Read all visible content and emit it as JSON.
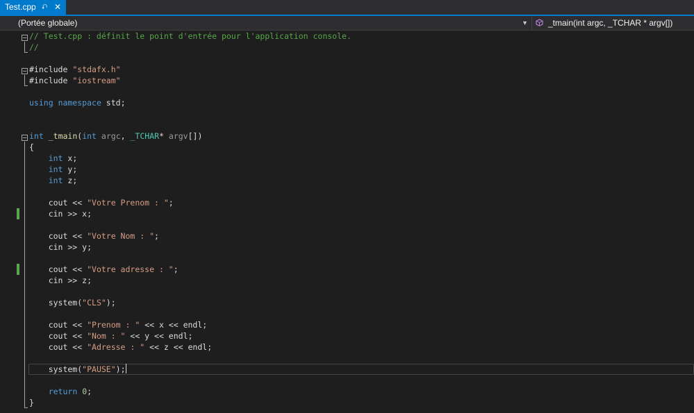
{
  "tab": {
    "title": "Test.cpp",
    "pin_icon": "pin-icon",
    "close_icon": "close-icon",
    "accent": "#007acc"
  },
  "navbar": {
    "scope_label": "(Portée globale)",
    "member_label": "_tmain(int argc, _TCHAR * argv[])",
    "member_icon": "function-cube-icon"
  },
  "code": {
    "lines": [
      [
        {
          "t": "// Test.cpp : définit le point d'entrée pour l'application console.",
          "c": "cmt"
        }
      ],
      [
        {
          "t": "//",
          "c": "cmt"
        }
      ],
      [],
      [
        {
          "t": "#include ",
          "c": ""
        },
        {
          "t": "\"stdafx.h\"",
          "c": "str"
        }
      ],
      [
        {
          "t": "#include ",
          "c": ""
        },
        {
          "t": "\"iostream\"",
          "c": "str"
        }
      ],
      [],
      [
        {
          "t": "using",
          "c": "kw"
        },
        {
          "t": " ",
          "c": ""
        },
        {
          "t": "namespace",
          "c": "kw"
        },
        {
          "t": " std;",
          "c": ""
        }
      ],
      [],
      [],
      [
        {
          "t": "int",
          "c": "kw"
        },
        {
          "t": " ",
          "c": ""
        },
        {
          "t": "_tmain",
          "c": "fn"
        },
        {
          "t": "(",
          "c": ""
        },
        {
          "t": "int",
          "c": "kw"
        },
        {
          "t": " ",
          "c": ""
        },
        {
          "t": "argc",
          "c": "param"
        },
        {
          "t": ", ",
          "c": ""
        },
        {
          "t": "_TCHAR",
          "c": "ty"
        },
        {
          "t": "* ",
          "c": ""
        },
        {
          "t": "argv",
          "c": "param"
        },
        {
          "t": "[])",
          "c": ""
        }
      ],
      [
        {
          "t": "{",
          "c": ""
        }
      ],
      [
        {
          "t": "    ",
          "c": ""
        },
        {
          "t": "int",
          "c": "kw"
        },
        {
          "t": " x;",
          "c": ""
        }
      ],
      [
        {
          "t": "    ",
          "c": ""
        },
        {
          "t": "int",
          "c": "kw"
        },
        {
          "t": " y;",
          "c": ""
        }
      ],
      [
        {
          "t": "    ",
          "c": ""
        },
        {
          "t": "int",
          "c": "kw"
        },
        {
          "t": " z;",
          "c": ""
        }
      ],
      [],
      [
        {
          "t": "    cout << ",
          "c": ""
        },
        {
          "t": "\"Votre Prenom : \"",
          "c": "str"
        },
        {
          "t": ";",
          "c": ""
        }
      ],
      [
        {
          "t": "    cin >> x;",
          "c": ""
        }
      ],
      [],
      [
        {
          "t": "    cout << ",
          "c": ""
        },
        {
          "t": "\"Votre Nom : \"",
          "c": "str"
        },
        {
          "t": ";",
          "c": ""
        }
      ],
      [
        {
          "t": "    cin >> y;",
          "c": ""
        }
      ],
      [],
      [
        {
          "t": "    cout << ",
          "c": ""
        },
        {
          "t": "\"Votre adresse : \"",
          "c": "str"
        },
        {
          "t": ";",
          "c": ""
        }
      ],
      [
        {
          "t": "    cin >> z;",
          "c": ""
        }
      ],
      [],
      [
        {
          "t": "    system(",
          "c": ""
        },
        {
          "t": "\"CLS\"",
          "c": "str"
        },
        {
          "t": ");",
          "c": ""
        }
      ],
      [],
      [
        {
          "t": "    cout << ",
          "c": ""
        },
        {
          "t": "\"Prenom : \"",
          "c": "str"
        },
        {
          "t": " << x << endl;",
          "c": ""
        }
      ],
      [
        {
          "t": "    cout << ",
          "c": ""
        },
        {
          "t": "\"Nom : \"",
          "c": "str"
        },
        {
          "t": " << y << endl;",
          "c": ""
        }
      ],
      [
        {
          "t": "    cout << ",
          "c": ""
        },
        {
          "t": "\"Adresse : \"",
          "c": "str"
        },
        {
          "t": " << z << endl;",
          "c": ""
        }
      ],
      [],
      [
        {
          "t": "    system(",
          "c": ""
        },
        {
          "t": "\"PAUSE\"",
          "c": "str"
        },
        {
          "t": ");",
          "c": ""
        }
      ],
      [],
      [
        {
          "t": "    ",
          "c": ""
        },
        {
          "t": "return",
          "c": "kw"
        },
        {
          "t": " ",
          "c": ""
        },
        {
          "t": "0",
          "c": "num"
        },
        {
          "t": ";",
          "c": ""
        }
      ],
      [
        {
          "t": "}",
          "c": ""
        }
      ]
    ],
    "caret_line": 30,
    "changed_lines": [
      16,
      21
    ]
  }
}
